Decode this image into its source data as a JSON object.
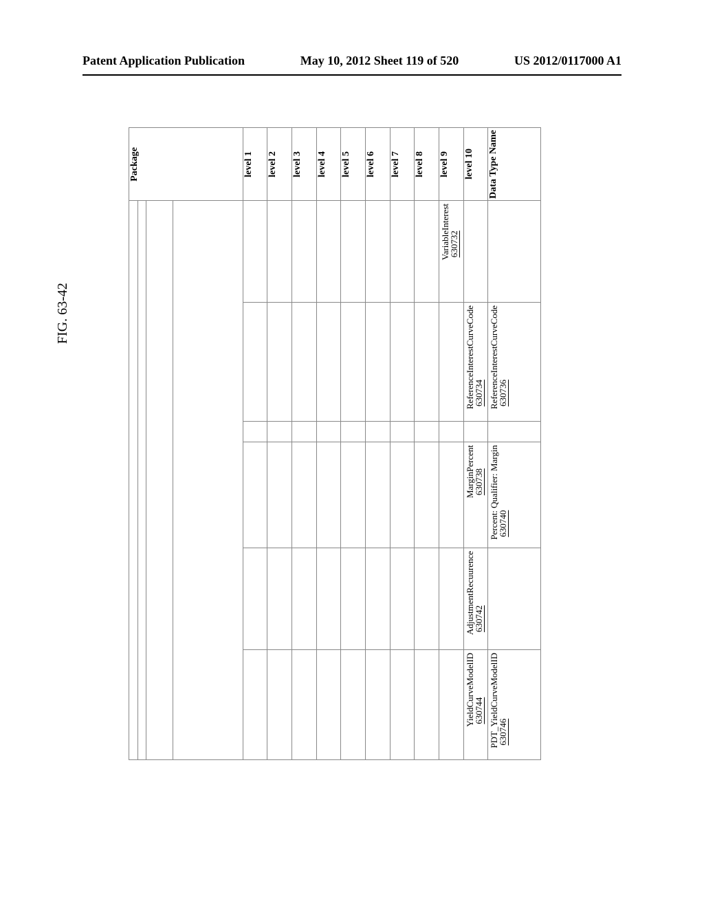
{
  "header": {
    "left": "Patent Application Publication",
    "center": "May 10, 2012  Sheet 119 of 520",
    "right": "US 2012/0117000 A1"
  },
  "figure_label": "FIG. 63-42",
  "columns": {
    "package": "Package",
    "level1": "level 1",
    "level2": "level 2",
    "level3": "level 3",
    "level4": "level 4",
    "level5": "level 5",
    "level6": "level 6",
    "level7": "level 7",
    "level8": "level 8",
    "level9": "level 9",
    "level10": "level 10",
    "dtn": "Data Type Name"
  },
  "rows": [
    {
      "level9": {
        "text": "VariableInterest",
        "ref": "630732"
      },
      "level10": null,
      "dtn": null
    },
    {
      "level9": null,
      "level10": {
        "text": "ReferenceInterestCurveCode",
        "ref": "630734"
      },
      "dtn": {
        "text": "ReferenceInterestCurveCode",
        "ref": "630736"
      }
    },
    {
      "level9": null,
      "level10": {
        "text": "MarginPercent",
        "ref": "630738"
      },
      "dtn": {
        "text": "Percent: Qualifier: Margin",
        "ref": "630740"
      }
    },
    {
      "level9": null,
      "level10": {
        "text": "AdjustmentRecuurence",
        "ref": "630742"
      },
      "dtn": null
    },
    {
      "level9": null,
      "level10": {
        "text": "YieldCurveModelID",
        "ref": "630744"
      },
      "dtn": {
        "text": "PDT_YieldCurveModelID",
        "ref": "630746"
      }
    }
  ]
}
